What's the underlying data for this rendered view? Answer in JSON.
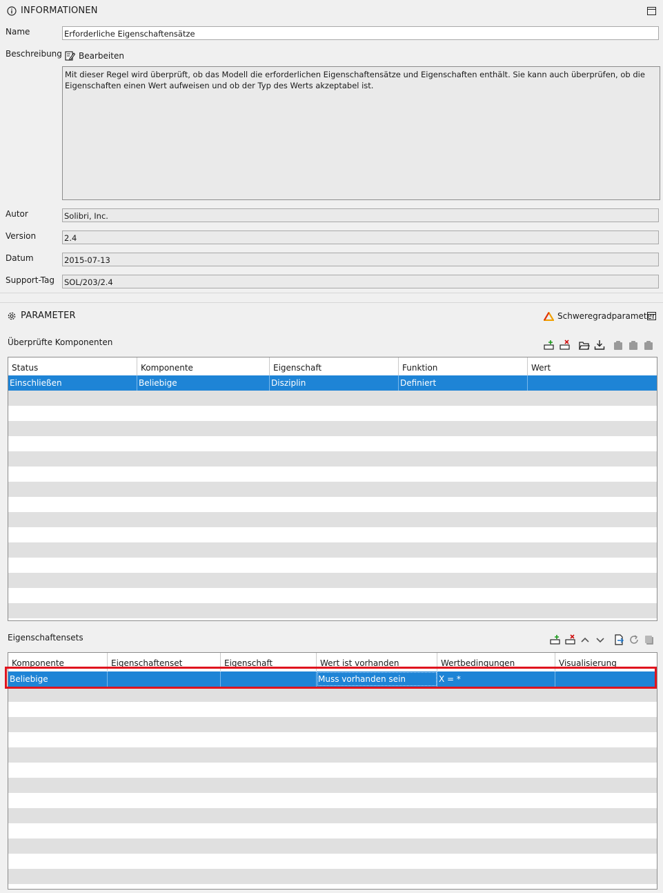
{
  "info": {
    "title": "INFORMATIONEN",
    "name_label": "Name",
    "name_value": "Erforderliche Eigenschaftensätze",
    "desc_label": "Beschreibung",
    "edit_label": "Bearbeiten",
    "description": "Mit dieser Regel wird überprüft, ob das Modell die erforderlichen Eigenschaftensätze und Eigenschaften enthält. Sie kann auch überprüfen, ob die Eigenschaften einen Wert aufweisen und ob der Typ des Werts akzeptabel ist.",
    "author_label": "Autor",
    "author_value": "Solibri, Inc.",
    "version_label": "Version",
    "version_value": "2.4",
    "date_label": "Datum",
    "date_value": "2015-07-13",
    "support_label": "Support-Tag",
    "support_value": "SOL/203/2.4"
  },
  "params": {
    "title": "PARAMETER",
    "severity_label": "Schweregradparameter"
  },
  "components": {
    "label": "Überprüfte Komponenten",
    "columns": [
      "Status",
      "Komponente",
      "Eigenschaft",
      "Funktion",
      "Wert"
    ],
    "rows": [
      [
        "Einschließen",
        "Beliebige",
        "Disziplin",
        "Definiert",
        ""
      ]
    ]
  },
  "propsets": {
    "label": "Eigenschaftensets",
    "columns": [
      "Komponente",
      "Eigenschaftenset",
      "Eigenschaft",
      "Wert ist vorhanden",
      "Wertbedingungen",
      "Visualisierung"
    ],
    "rows": [
      [
        "Beliebige",
        "",
        "",
        "Muss vorhanden sein",
        "X = *",
        ""
      ]
    ]
  },
  "colors": {
    "selection": "#1e84d6",
    "highlight_border": "#e0141e",
    "alt_row": "#e0e0e0"
  }
}
